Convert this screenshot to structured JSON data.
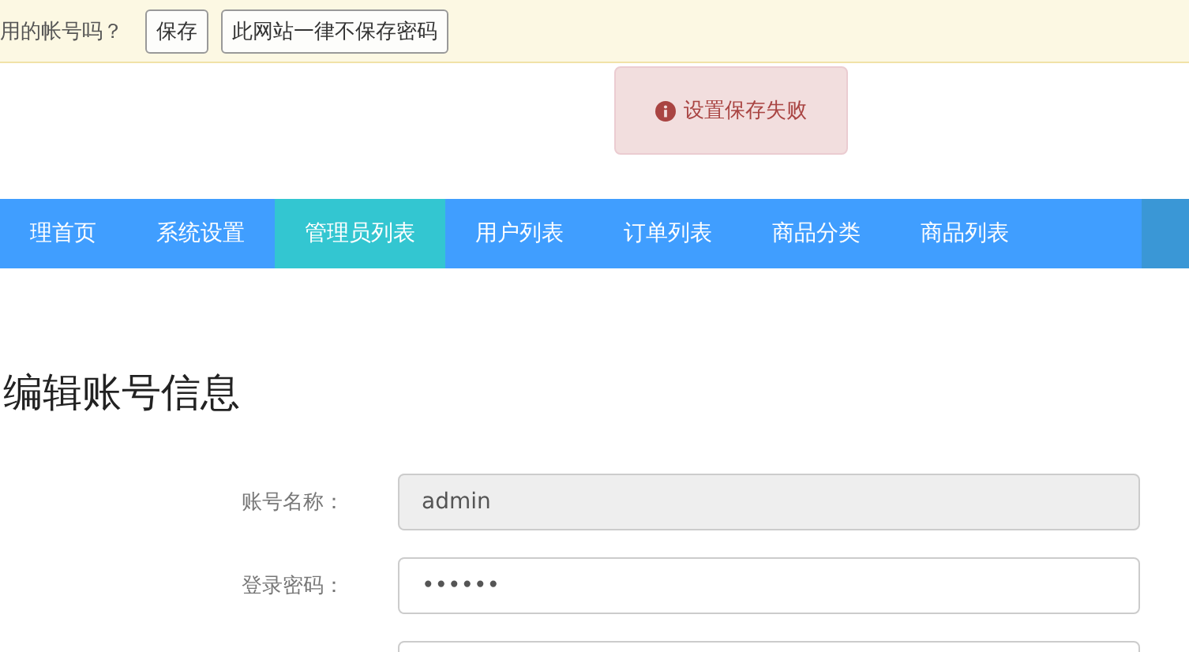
{
  "save_password_bar": {
    "prompt": "用的帐号吗？",
    "buttons": [
      "保存",
      "此网站一律不保存密码"
    ]
  },
  "toast": {
    "message": "设置保存失败"
  },
  "nav": {
    "items": [
      {
        "label": "理首页",
        "selected": false
      },
      {
        "label": "系统设置",
        "selected": false
      },
      {
        "label": "管理员列表",
        "selected": true
      },
      {
        "label": "用户列表",
        "selected": false
      },
      {
        "label": "订单列表",
        "selected": false
      },
      {
        "label": "商品分类",
        "selected": false
      },
      {
        "label": "商品列表",
        "selected": false
      }
    ]
  },
  "form": {
    "title": "编辑账号信息",
    "fields": [
      {
        "label": "账号名称：",
        "value": "admin",
        "disabled": true
      },
      {
        "label": "登录密码：",
        "value": "••••••",
        "disabled": false
      },
      {
        "disabled": false
      }
    ]
  }
}
